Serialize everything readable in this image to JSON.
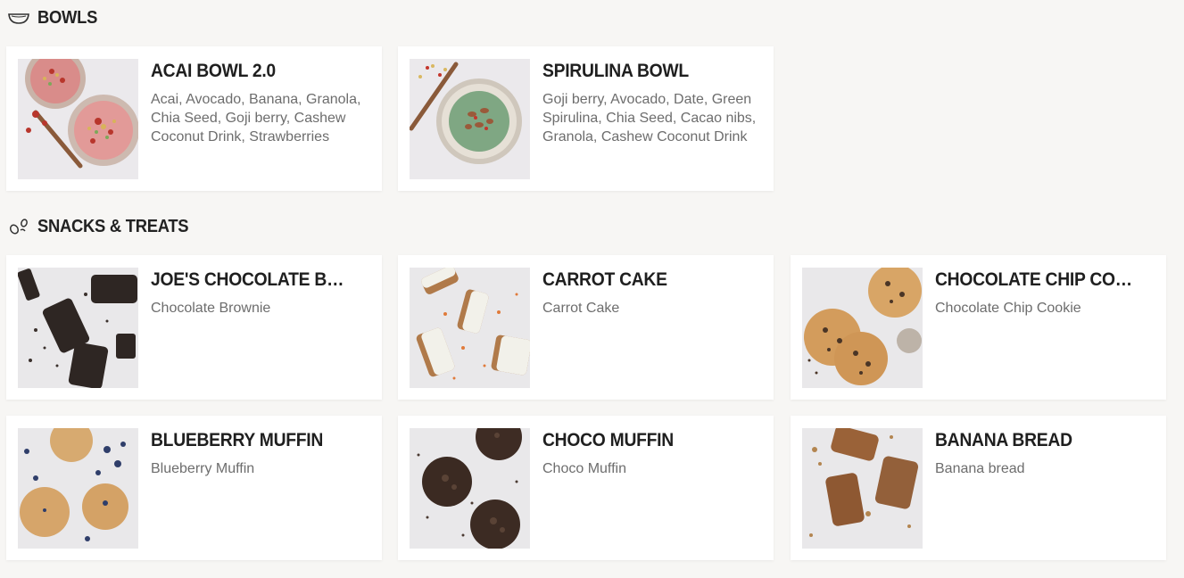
{
  "sections": [
    {
      "title": "BOWLS",
      "icon": "bowl-icon",
      "items": [
        {
          "name": "ACAI BOWL 2.0",
          "description": "Acai, Avocado, Banana, Granola, Chia Seed, Goji berry, Cashew Coconut Drink, Strawberries"
        },
        {
          "name": "SPIRULINA BOWL",
          "description": "Goji berry, Avocado, Date, Green Spirulina, Chia Seed, Cacao nibs, Granola, Cashew Coconut Drink"
        }
      ]
    },
    {
      "title": "SNACKS & TREATS",
      "icon": "snack-seeds-icon",
      "items": [
        {
          "name": "JOE'S CHOCOLATE BROWNIE",
          "description": "Chocolate Brownie"
        },
        {
          "name": "CARROT CAKE",
          "description": "Carrot Cake"
        },
        {
          "name": "CHOCOLATE CHIP COOKIE",
          "description": "Chocolate Chip Cookie"
        },
        {
          "name": "BLUEBERRY MUFFIN",
          "description": "Blueberry Muffin"
        },
        {
          "name": "CHOCO MUFFIN",
          "description": "Choco Muffin"
        },
        {
          "name": "BANANA BREAD",
          "description": "Banana bread"
        }
      ]
    }
  ]
}
